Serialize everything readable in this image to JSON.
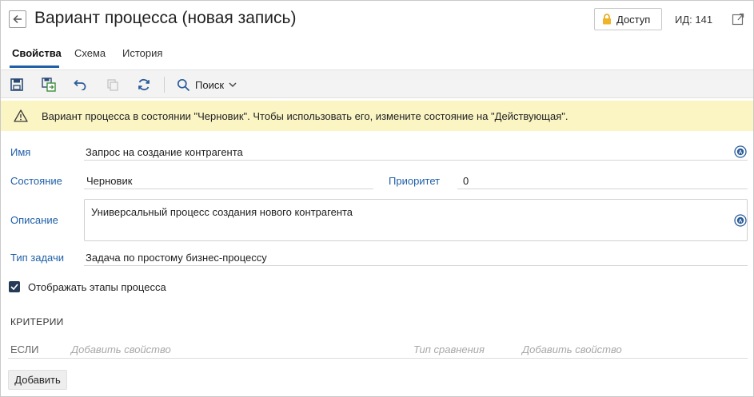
{
  "header": {
    "title": "Вариант процесса (новая запись)",
    "access_label": "Доступ",
    "id_label": "ИД: 141"
  },
  "tabs": [
    {
      "label": "Свойства",
      "active": true
    },
    {
      "label": "Схема",
      "active": false
    },
    {
      "label": "История",
      "active": false
    }
  ],
  "toolbar": {
    "search_label": "Поиск"
  },
  "banner": {
    "text": "Вариант процесса в состоянии \"Черновик\". Чтобы использовать его, измените состояние на \"Действующая\"."
  },
  "form": {
    "name_label": "Имя",
    "name_value": "Запрос на создание контрагента",
    "state_label": "Состояние",
    "state_value": "Черновик",
    "priority_label": "Приоритет",
    "priority_value": "0",
    "description_label": "Описание",
    "description_value": "Универсальный процесс создания нового контрагента",
    "task_type_label": "Тип задачи",
    "task_type_value": "Задача по простому бизнес-процессу",
    "show_stages_label": "Отображать этапы процесса",
    "show_stages_checked": true
  },
  "criteria": {
    "title": "КРИТЕРИИ",
    "if_label": "ЕСЛИ",
    "property_placeholder": "Добавить свойство",
    "compare_placeholder": "Тип сравнения",
    "value_placeholder": "Добавить свойство",
    "add_button": "Добавить"
  },
  "colors": {
    "accent": "#1f5fa8",
    "banner_bg": "#fbf5c4",
    "checkbox": "#253a56"
  }
}
